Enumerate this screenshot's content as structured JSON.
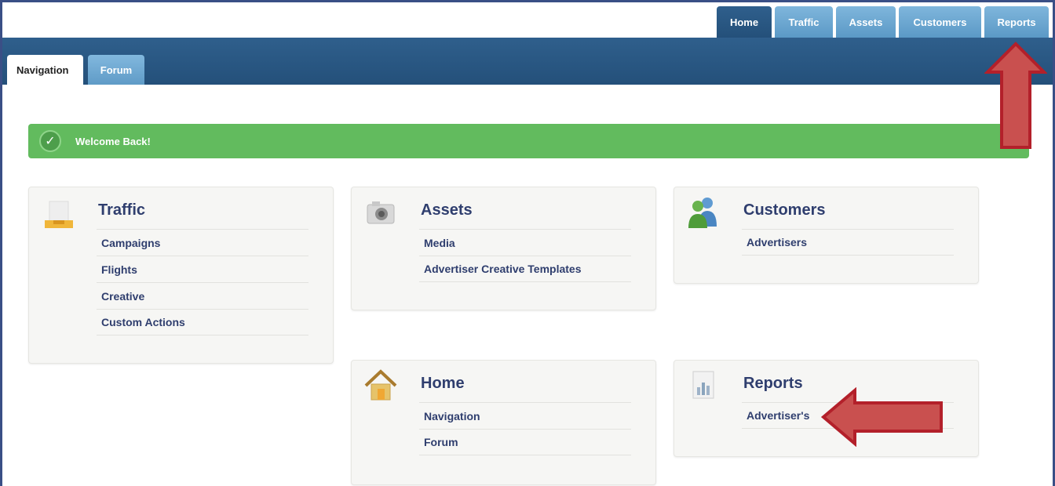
{
  "top_tabs": [
    {
      "label": "Home",
      "active": true
    },
    {
      "label": "Traffic",
      "active": false
    },
    {
      "label": "Assets",
      "active": false
    },
    {
      "label": "Customers",
      "active": false
    },
    {
      "label": "Reports",
      "active": false
    }
  ],
  "sub_tabs": [
    {
      "label": "Navigation",
      "active": true
    },
    {
      "label": "Forum",
      "active": false
    }
  ],
  "welcome": {
    "message": "Welcome Back!"
  },
  "cards": {
    "traffic": {
      "title": "Traffic",
      "links": [
        "Campaigns",
        "Flights",
        "Creative",
        "Custom Actions"
      ]
    },
    "assets": {
      "title": "Assets",
      "links": [
        "Media",
        "Advertiser Creative Templates"
      ]
    },
    "customers": {
      "title": "Customers",
      "links": [
        "Advertisers"
      ]
    },
    "home": {
      "title": "Home",
      "links": [
        "Navigation",
        "Forum"
      ]
    },
    "reports": {
      "title": "Reports",
      "links": [
        "Advertiser's"
      ]
    }
  },
  "colors": {
    "header_blue": "#2f5f8c",
    "tab_light_blue": "#6aa6d2",
    "success_green": "#62bb5e",
    "link_navy": "#2f3e6e",
    "annotation_red": "#c9504f"
  },
  "icons": {
    "traffic": "inbox-tray-icon",
    "assets": "camera-icon",
    "customers": "users-icon",
    "home": "house-icon",
    "reports": "bar-chart-document-icon",
    "welcome": "check-circle-icon"
  }
}
